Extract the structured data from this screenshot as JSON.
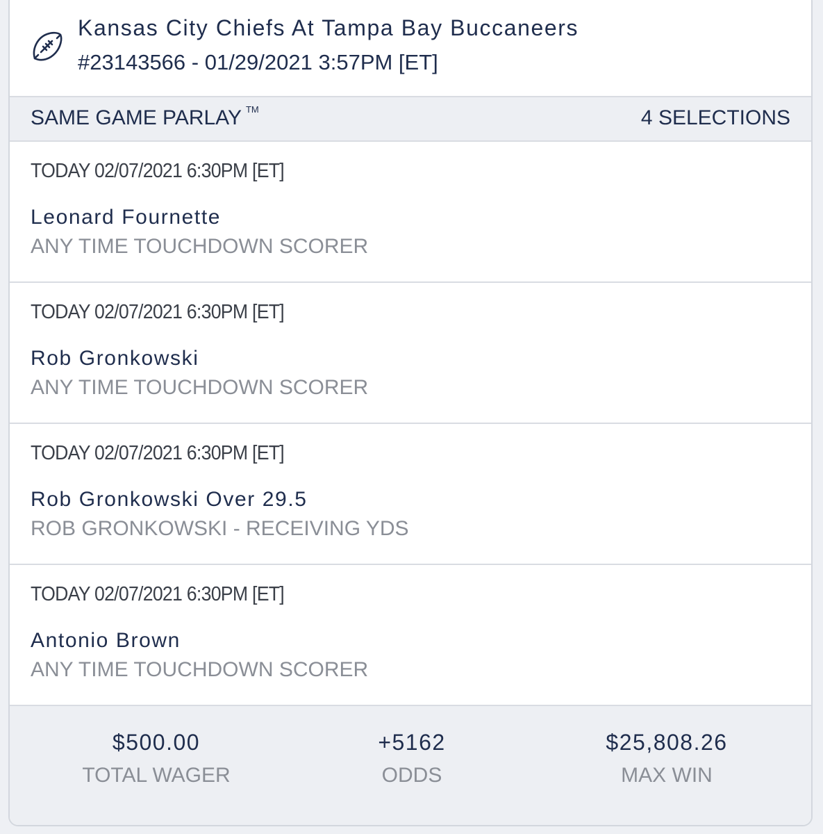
{
  "header": {
    "icon": "football-icon",
    "title": "Kansas City Chiefs At Tampa Bay Buccaneers",
    "subtitle": "#23143566 - 01/29/2021 3:57PM [ET]"
  },
  "parlay": {
    "label": "SAME GAME PARLAY",
    "trademark": "TM",
    "count": "4 SELECTIONS"
  },
  "selections": [
    {
      "date": "TODAY 02/07/2021 6:30PM [ET]",
      "name": "Leonard Fournette",
      "market": "ANY TIME TOUCHDOWN SCORER"
    },
    {
      "date": "TODAY 02/07/2021 6:30PM [ET]",
      "name": "Rob Gronkowski",
      "market": "ANY TIME TOUCHDOWN SCORER"
    },
    {
      "date": "TODAY 02/07/2021 6:30PM [ET]",
      "name": "Rob Gronkowski Over 29.5",
      "market": "ROB GRONKOWSKI - RECEIVING YDS"
    },
    {
      "date": "TODAY 02/07/2021 6:30PM [ET]",
      "name": "Antonio Brown",
      "market": "ANY TIME TOUCHDOWN SCORER"
    }
  ],
  "footer": {
    "wager_value": "$500.00",
    "wager_label": "TOTAL WAGER",
    "odds_value": "+5162",
    "odds_label": "ODDS",
    "win_value": "$25,808.26",
    "win_label": "MAX WIN"
  },
  "colors": {
    "navy_text": "#1f2d4d",
    "muted_text": "#8a8e96",
    "bar_background": "#edeff3",
    "divider": "#d9dce2"
  }
}
